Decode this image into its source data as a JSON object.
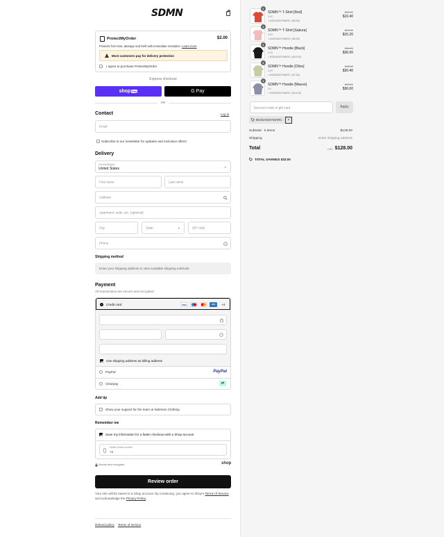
{
  "brand": {
    "logo_text": "SDMN"
  },
  "protect": {
    "title": "ProtectMyOrder",
    "price": "$2.00",
    "description": "Protects from loss, damage and theft with immediate resolution.",
    "learn_more": "Learn more",
    "warning": "Most customers pay for delivery protection",
    "agree_label": "I agree to purchase ProtectMyOrder"
  },
  "express": {
    "label": "Express checkout",
    "shop_pay": "shop",
    "shop_pay_badge": "Pay",
    "gpay": "G Pay",
    "or": "OR"
  },
  "contact": {
    "heading": "Contact",
    "login": "Log in",
    "email_placeholder": "Email",
    "newsletter": "Subscribe to our newsletter for updates and exclusive offers!"
  },
  "delivery": {
    "heading": "Delivery",
    "country_label": "Country/Region",
    "country_value": "United States",
    "first_name": "First name",
    "last_name": "Last name",
    "address": "Address",
    "apartment": "Apartment, suite, etc. (optional)",
    "city": "City",
    "state": "State",
    "zip": "ZIP code",
    "phone": "Phone"
  },
  "shipping_method": {
    "heading": "Shipping method",
    "info": "Enter your shipping address to view available shipping methods."
  },
  "payment": {
    "heading": "Payment",
    "subtitle": "All transactions are secure and encrypted.",
    "credit_card": "Credit card",
    "more_cards": "+4",
    "billing_same": "Use shipping address as billing address",
    "paypal": "PayPal",
    "paypal_logo": "PayPal",
    "clearpay": "Clearpay"
  },
  "tip": {
    "heading": "Add tip",
    "label": "Show your support for the team at Sidemen Clothing"
  },
  "remember": {
    "heading": "Remember me",
    "save_label": "Save my information for a faster checkout with a Shop account",
    "phone_label": "Mobile phone number",
    "phone_value": "+1",
    "secure": "Secure and encrypted",
    "shop_logo": "shop"
  },
  "review_button": "Review order",
  "legal": {
    "text1": "Your info will be saved to a Shop account. By continuing, you agree to Shop's ",
    "terms": "Terms of Service",
    "text2": " and acknowledge the ",
    "privacy": "Privacy Policy",
    "text3": "."
  },
  "footer": {
    "refund": "Refund policy",
    "terms": "Terms of service"
  },
  "cart": {
    "items": [
      {
        "name": "SDMN™ T-Shirt [Red]",
        "size": "XXS",
        "discount": "BIGDADDYMARC (-$5.60)",
        "old_price": "$16.00",
        "price": "$10.40",
        "qty": "1",
        "color": "#d94a38"
      },
      {
        "name": "SDMN™ T-Shirt [Sakura]",
        "size": "XXS",
        "discount": "BIGDADDYMARC (-$8.80)",
        "old_price": "$24.00",
        "price": "$15.20",
        "qty": "1",
        "color": "#f3bcbc"
      },
      {
        "name": "SDMN™ Hoodie [Black]",
        "size": "XXS",
        "discount": "BIGDADDYMARC (-$19.00)",
        "old_price": "$55.00",
        "price": "$36.00",
        "qty": "1",
        "color": "#1a1a1a"
      },
      {
        "name": "SDMN™ Hoodie [Olive]",
        "size": "XXS",
        "discount": "BIGDADDYMARC (-$7.60)",
        "old_price": "$38.00",
        "price": "$30.40",
        "qty": "1",
        "color": "#c8cba6"
      },
      {
        "name": "SDMN™ Hoodie [Mauve]",
        "size": "XS",
        "discount": "BIGDADDYMARC (-$19.00)",
        "old_price": "$55.00",
        "price": "$36.00",
        "qty": "1",
        "color": "#8d8ea8"
      }
    ],
    "discount_placeholder": "Discount code or gift card",
    "apply": "Apply",
    "applied_code": "BIGDADDYMARC",
    "remove": "×",
    "subtotal_label": "Subtotal · 5 items",
    "subtotal_value": "$128.00",
    "shipping_label": "Shipping",
    "shipping_value": "Enter shipping address",
    "total_label": "Total",
    "currency": "USD",
    "total_value": "$128.00",
    "savings_label": "TOTAL SAVINGS",
    "savings_value": "$32.00"
  }
}
